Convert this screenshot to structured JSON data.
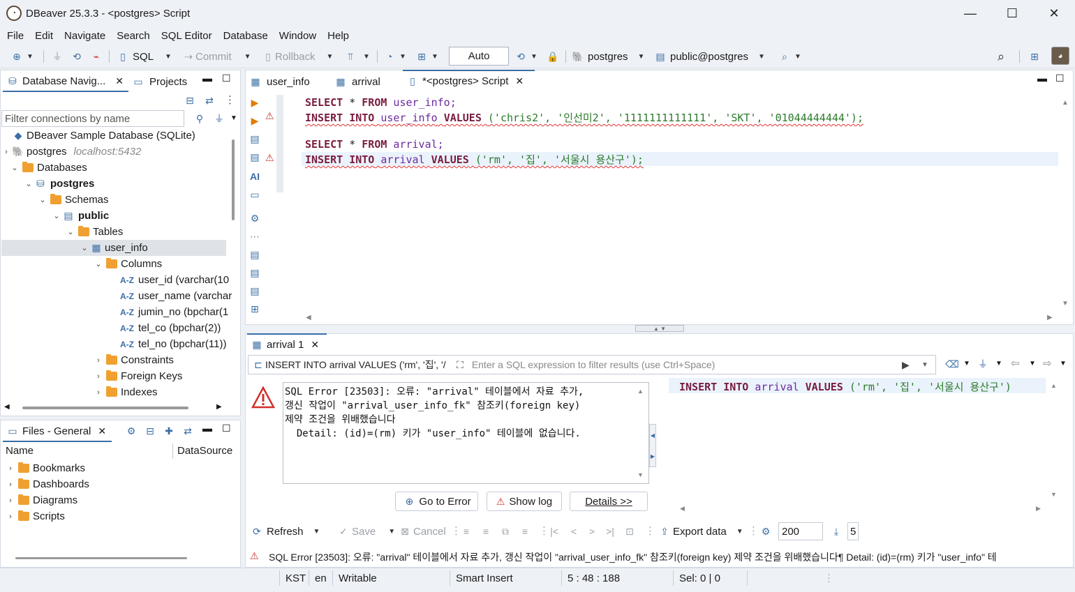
{
  "window": {
    "title": "DBeaver 25.3.3 - <postgres> Script"
  },
  "menu": [
    "File",
    "Edit",
    "Navigate",
    "Search",
    "SQL Editor",
    "Database",
    "Window",
    "Help"
  ],
  "toolbar": {
    "sql_label": "SQL",
    "commit_label": "Commit",
    "rollback_label": "Rollback",
    "transaction_mode": "Auto",
    "connection": "postgres",
    "schema": "public@postgres"
  },
  "navigator": {
    "tab_label": "Database Navig...",
    "projects_tab": "Projects",
    "filter_placeholder": "Filter connections by name",
    "tree": [
      {
        "label": "DBeaver Sample Database (SQLite)"
      },
      {
        "label": "postgres",
        "host": "localhost:5432"
      },
      {
        "label": "Databases"
      },
      {
        "label": "postgres"
      },
      {
        "label": "Schemas"
      },
      {
        "label": "public"
      },
      {
        "label": "Tables"
      },
      {
        "label": "user_info"
      },
      {
        "label": "Columns"
      },
      {
        "label": "user_id (varchar(10"
      },
      {
        "label": "user_name (varchar"
      },
      {
        "label": "jumin_no (bpchar(1"
      },
      {
        "label": "tel_co (bpchar(2))"
      },
      {
        "label": "tel_no (bpchar(11))"
      },
      {
        "label": "Constraints"
      },
      {
        "label": "Foreign Keys"
      },
      {
        "label": "Indexes"
      }
    ]
  },
  "files": {
    "tab_label": "Files - General",
    "col_name": "Name",
    "col_datasource": "DataSource",
    "items": [
      "Bookmarks",
      "Dashboards",
      "Diagrams",
      "Scripts"
    ]
  },
  "editor": {
    "tabs": [
      "user_info",
      "arrival",
      "*<postgres> Script"
    ],
    "lines": {
      "l1": {
        "kw1": "SELECT",
        "star": " * ",
        "kw2": "FROM",
        "tbl": " user_info;"
      },
      "l2": {
        "kw": "INSERT INTO",
        "tbl": "user_info",
        "kw2": "VALUES",
        "vals": "('chris2', '인선미2', '1111111111111', 'SKT', '01044444444');"
      },
      "l4": {
        "kw1": "SELECT",
        "star": " * ",
        "kw2": "FROM",
        "tbl": " arrival;"
      },
      "l5": {
        "kw": "INSERT INTO",
        "tbl": "arrival",
        "kw2": "VALUES",
        "vals": "('rm', '집', '서울시 용산구');"
      }
    }
  },
  "results": {
    "tab_label": "arrival 1",
    "query_label": "INSERT INTO arrival VALUES ('rm', '집', '/",
    "filter_placeholder": "Enter a SQL expression to filter results (use Ctrl+Space)",
    "error_text": "SQL Error [23503]: 오류: \"arrival\" 테이블에서 자료 추가,\n갱신 작업이 \"arrival_user_info_fk\" 참조키(foreign key)\n제약 조건을 위배했습니다\n  Detail: (id)=(rm) 키가 \"user_info\" 테이블에 없습니다.",
    "query_preview": {
      "kw": "INSERT INTO",
      "tbl": "arrival",
      "kw2": "VALUES",
      "vals": "('rm', '집', '서울시 용산구')"
    },
    "go_to_error": "Go to Error",
    "show_log": "Show log",
    "details": "Details >>",
    "refresh": "Refresh",
    "save": "Save",
    "cancel": "Cancel",
    "export": "Export data",
    "fetch_size": "200",
    "row_count": "5",
    "status_message": "SQL Error [23503]: 오류: \"arrival\" 테이블에서 자료 추가, 갱신 작업이 \"arrival_user_info_fk\" 참조키(foreign key) 제약 조건을 위배했습니다¶  Detail: (id)=(rm) 키가 \"user_info\" 테"
  },
  "statusbar": {
    "tz": "KST",
    "locale": "en",
    "mode": "Writable",
    "insert": "Smart Insert",
    "position": "5 : 48 : 188",
    "selection": "Sel: 0 | 0"
  }
}
